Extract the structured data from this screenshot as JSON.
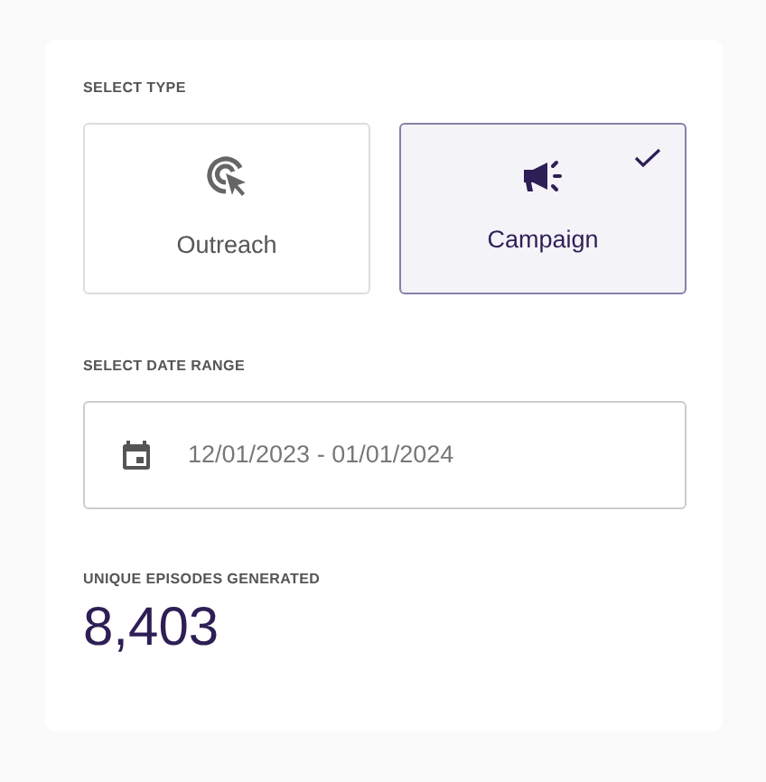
{
  "type_section": {
    "label": "SELECT TYPE",
    "options": [
      {
        "kind": "target",
        "label": "Outreach",
        "selected": false
      },
      {
        "kind": "megaphone",
        "label": "Campaign",
        "selected": true
      }
    ]
  },
  "date_section": {
    "label": "SELECT DATE RANGE",
    "value": "12/01/2023 - 01/01/2024"
  },
  "stat": {
    "label": "UNIQUE EPISODES GENERATED",
    "value": "8,403"
  }
}
